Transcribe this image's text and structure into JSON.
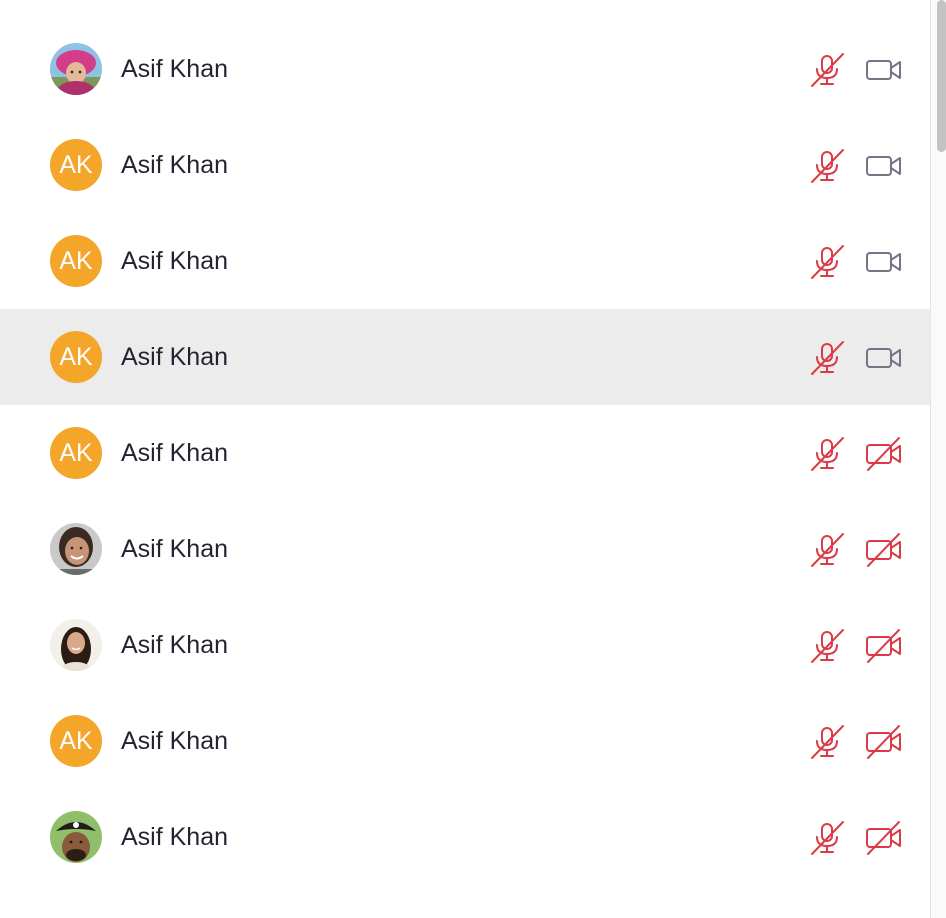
{
  "participants": [
    {
      "name": "Asif Khan",
      "avatar": {
        "type": "photo",
        "photo": "pink-hat"
      },
      "audio": "muted",
      "video": "on"
    },
    {
      "name": "Asif Khan",
      "avatar": {
        "type": "initials",
        "initials": "AK"
      },
      "audio": "muted",
      "video": "on"
    },
    {
      "name": "Asif Khan",
      "avatar": {
        "type": "initials",
        "initials": "AK"
      },
      "audio": "muted",
      "video": "on"
    },
    {
      "name": "Asif Khan",
      "avatar": {
        "type": "initials",
        "initials": "AK"
      },
      "audio": "muted",
      "video": "on",
      "highlighted": true
    },
    {
      "name": "Asif Khan",
      "avatar": {
        "type": "initials",
        "initials": "AK"
      },
      "audio": "muted",
      "video": "off"
    },
    {
      "name": "Asif Khan",
      "avatar": {
        "type": "photo",
        "photo": "smiling-face"
      },
      "audio": "muted",
      "video": "off"
    },
    {
      "name": "Asif Khan",
      "avatar": {
        "type": "photo",
        "photo": "long-hair"
      },
      "audio": "muted",
      "video": "off"
    },
    {
      "name": "Asif Khan",
      "avatar": {
        "type": "initials",
        "initials": "AK"
      },
      "audio": "muted",
      "video": "off"
    },
    {
      "name": "Asif Khan",
      "avatar": {
        "type": "photo",
        "photo": "pirate-hat"
      },
      "audio": "muted",
      "video": "off"
    }
  ],
  "icons": {
    "audio_muted": "microphone-muted-icon",
    "video_on": "video-camera-icon",
    "video_off": "video-camera-off-icon"
  },
  "colors": {
    "initials_avatar_bg": "#f4a62a",
    "muted_red": "#d93c46",
    "icon_gray": "#747487",
    "highlight_row": "#ececec",
    "name_text": "#232333"
  }
}
